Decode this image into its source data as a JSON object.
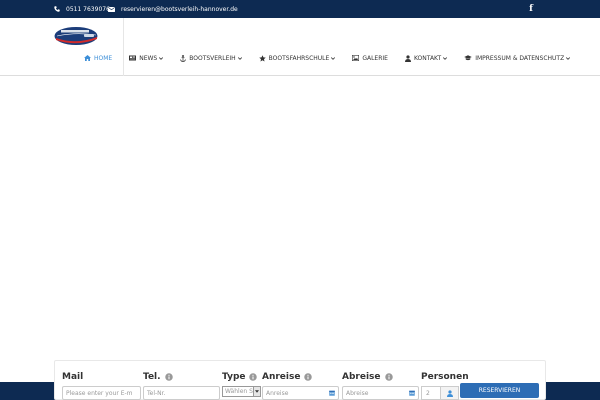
{
  "colors": {
    "topbar_bg": "#0d2a52",
    "nav_active": "#3d8fd8",
    "button_bg": "#2d6db5"
  },
  "topbar": {
    "phone": "0511 7639076",
    "email": "reservieren@bootsverleih-hannover.de",
    "social_icon": "facebook-icon"
  },
  "nav": {
    "items": [
      {
        "label": "Home",
        "icon": "home-icon"
      },
      {
        "label": "News",
        "icon": "newspaper-icon"
      },
      {
        "label": "Bootsverleih",
        "icon": "anchor-icon"
      },
      {
        "label": "Bootsfahrschule",
        "icon": "star-icon"
      },
      {
        "label": "Galerie",
        "icon": "image-icon"
      },
      {
        "label": "Kontakt",
        "icon": "user-icon"
      },
      {
        "label": "Impressum & Datenschutz",
        "icon": "graduation-cap-icon"
      }
    ]
  },
  "booking": {
    "mail": {
      "label": "Mail",
      "placeholder": "Please enter your E-m"
    },
    "tel": {
      "label": "Tel.",
      "placeholder": "Tel-Nr."
    },
    "type": {
      "label": "Type",
      "selected": "Wählen S"
    },
    "arrival": {
      "label": "Anreise",
      "placeholder": "Anreise"
    },
    "departure": {
      "label": "Abreise",
      "placeholder": "Abreise"
    },
    "persons": {
      "label": "Personen",
      "value": "2"
    },
    "submit_label": "Reservieren"
  }
}
